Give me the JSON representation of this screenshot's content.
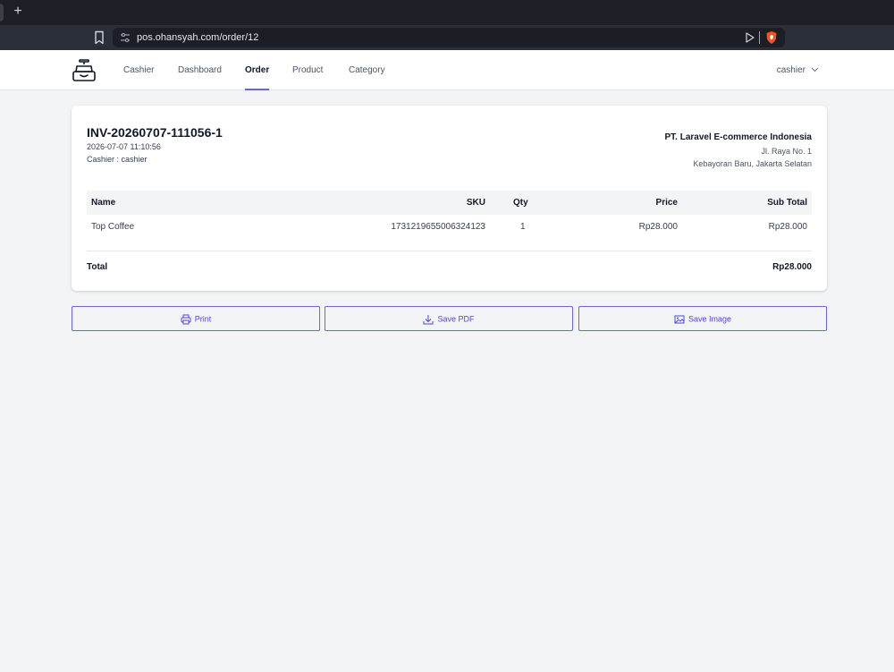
{
  "browser": {
    "new_tab": "+",
    "url": "pos.ohansyah.com/order/12"
  },
  "nav": {
    "items": [
      {
        "label": "Cashier"
      },
      {
        "label": "Dashboard"
      },
      {
        "label": "Order",
        "active": true
      },
      {
        "label": "Product"
      },
      {
        "label": "Category"
      }
    ],
    "user": "cashier"
  },
  "invoice": {
    "number": "INV-20260707-111056-1",
    "datetime": "2026-07-07 11:10:56",
    "cashier": "Cashier : cashier",
    "company": "PT. Laravel E-commerce Indonesia",
    "address_line1": "Jl. Raya No. 1",
    "address_line2": "Kebayoran Baru, Jakarta Selatan",
    "columns": [
      "Name",
      "SKU",
      "Qty",
      "Price",
      "Sub Total"
    ],
    "rows": [
      {
        "name": "Top Coffee",
        "sku": "1731219655006324123",
        "qty": "1",
        "price": "Rp28.000",
        "subtotal": "Rp28.000"
      }
    ],
    "total_label": "Total",
    "total_value": "Rp28.000"
  },
  "actions": {
    "print": "Print",
    "save_pdf": "Save PDF",
    "save_image": "Save Image"
  },
  "colors": {
    "accent": "#6366f1",
    "page_bg": "#f3f4f6",
    "chrome_dark": "#1c1f26"
  },
  "icons": [
    "bookmark-icon",
    "site-settings-icon",
    "send-icon",
    "brave-shield-icon",
    "cash-register-icon",
    "chevron-down-icon",
    "printer-icon",
    "download-icon",
    "image-icon"
  ]
}
